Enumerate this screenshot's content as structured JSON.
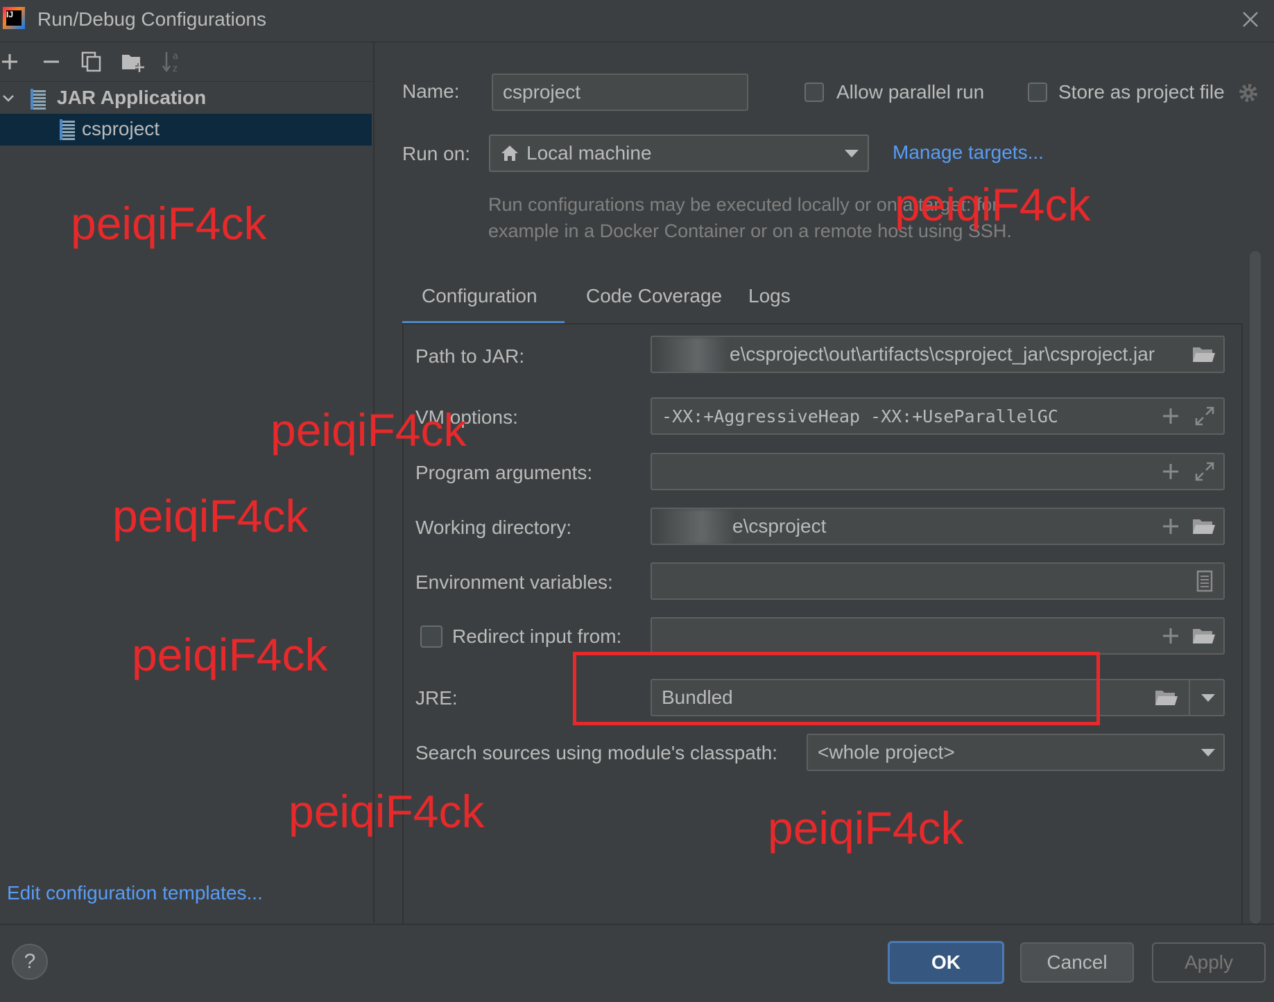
{
  "window": {
    "title": "Run/Debug Configurations"
  },
  "toolbar": {
    "icons": [
      "add-icon",
      "remove-icon",
      "copy-icon",
      "new-folder-icon",
      "sort-icon"
    ]
  },
  "tree": {
    "group_label": "JAR Application",
    "items": [
      {
        "label": "csproject",
        "selected": true
      }
    ]
  },
  "sidebar": {
    "edit_templates_link": "Edit configuration templates..."
  },
  "header": {
    "name_label": "Name:",
    "name_value": "csproject",
    "allow_parallel_label": "Allow parallel run",
    "store_project_label": "Store as project file",
    "run_on_label": "Run on:",
    "run_on_value": "Local machine",
    "manage_targets_link": "Manage targets...",
    "run_on_hint_line1": "Run configurations may be executed locally or on a target: for",
    "run_on_hint_line2": "example in a Docker Container or on a remote host using SSH."
  },
  "tabs": [
    {
      "label": "Configuration",
      "active": true
    },
    {
      "label": "Code Coverage",
      "active": false
    },
    {
      "label": "Logs",
      "active": false
    }
  ],
  "form": {
    "path_to_jar_label": "Path to JAR:",
    "path_to_jar_value": "e\\csproject\\out\\artifacts\\csproject_jar\\csproject.jar",
    "vm_options_label": "VM options:",
    "vm_options_value": "-XX:+AggressiveHeap -XX:+UseParallelGC",
    "program_args_label": "Program arguments:",
    "program_args_value": "",
    "working_dir_label": "Working directory:",
    "working_dir_value": "e\\csproject",
    "env_vars_label": "Environment variables:",
    "env_vars_value": "",
    "redirect_input_label": "Redirect input from:",
    "redirect_input_value": "",
    "jre_label": "JRE:",
    "jre_value": "Bundled",
    "search_sources_label": "Search sources using module's classpath:",
    "search_sources_value": "<whole project>"
  },
  "buttons": {
    "ok": "OK",
    "cancel": "Cancel",
    "apply": "Apply",
    "help": "?"
  },
  "watermark": {
    "text": "peiqiF4ck"
  },
  "colors": {
    "background": "#3c3f41",
    "selection": "#0d293e",
    "link": "#589df6",
    "accent_tab": "#4a88c7",
    "ok_button": "#365880",
    "annotation_red": "#e8292b"
  }
}
